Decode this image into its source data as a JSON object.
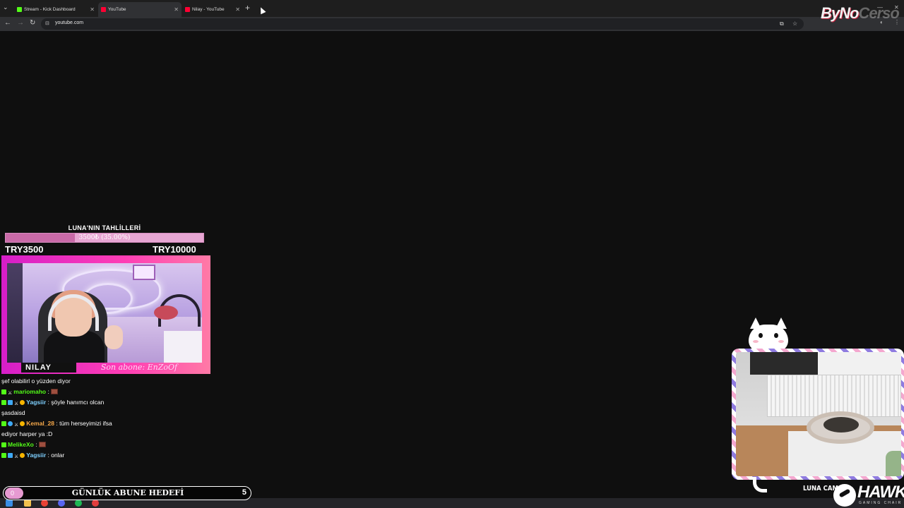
{
  "browser": {
    "tabs": [
      {
        "title": "Stream - Kick Dashboard",
        "favicon_color": "#53fc18",
        "active": false
      },
      {
        "title": "YouTube",
        "favicon_color": "#ff0033",
        "active": true
      },
      {
        "title": "Nilay - YouTube",
        "favicon_color": "#ff0033",
        "active": false
      }
    ],
    "url": "youtube.com",
    "logo_main": "ByNo",
    "logo_faded": "Cerso"
  },
  "donation_goal": {
    "title": "LUNA'NIN TAHLİLLERİ",
    "progress_text": "3500₺ (35.00%)",
    "progress_percent": 35,
    "min_label": "TRY3500",
    "max_label": "TRY10000"
  },
  "streamer_cam": {
    "name": "NILAY",
    "last_sub": "Son abone: EnZoOf"
  },
  "chat": {
    "messages": [
      {
        "user": "",
        "user_color": "#ffffff",
        "text": "şef olabilirl o yüzden diyor",
        "badges": []
      },
      {
        "user": "mariomaho",
        "user_color": "#53fc18",
        "text": "",
        "badges": [
          "kick",
          "mod"
        ],
        "emote": true
      },
      {
        "user": "Yagsiir",
        "user_color": "#7fd1ff",
        "text": "şöyle hanımcı olcan",
        "badges": [
          "kick",
          "sub",
          "mod",
          "gift"
        ]
      },
      {
        "user": "",
        "user_color": "#ffffff",
        "text": "şasdaisd",
        "badges": []
      },
      {
        "user": "Kemal_28",
        "user_color": "#f7a94a",
        "text": "tüm herseyimizi ifsa",
        "badges": [
          "kick",
          "og",
          "mod",
          "gift"
        ]
      },
      {
        "user": "",
        "user_color": "#ffffff",
        "text": "ediyor harper ya :D",
        "badges": []
      },
      {
        "user": "MelikeXo",
        "user_color": "#53fc18",
        "text": "",
        "badges": [
          "kick"
        ],
        "emote": true
      },
      {
        "user": "Yagsiir",
        "user_color": "#7fd1ff",
        "text": "onlar",
        "badges": [
          "kick",
          "sub",
          "mod",
          "gift"
        ]
      }
    ]
  },
  "sub_goal": {
    "current": "0",
    "label": "GÜNLÜK ABUNE HEDEFİ",
    "target": "5"
  },
  "pet_cam": {
    "label": "LUNA CAM"
  },
  "sponsor": {
    "name": "HAWK",
    "tagline": "GAMING CHAIR"
  },
  "colors": {
    "accent_pink": "#ff3fb4",
    "kick_green": "#53fc18",
    "background": "#0f0f0f"
  }
}
